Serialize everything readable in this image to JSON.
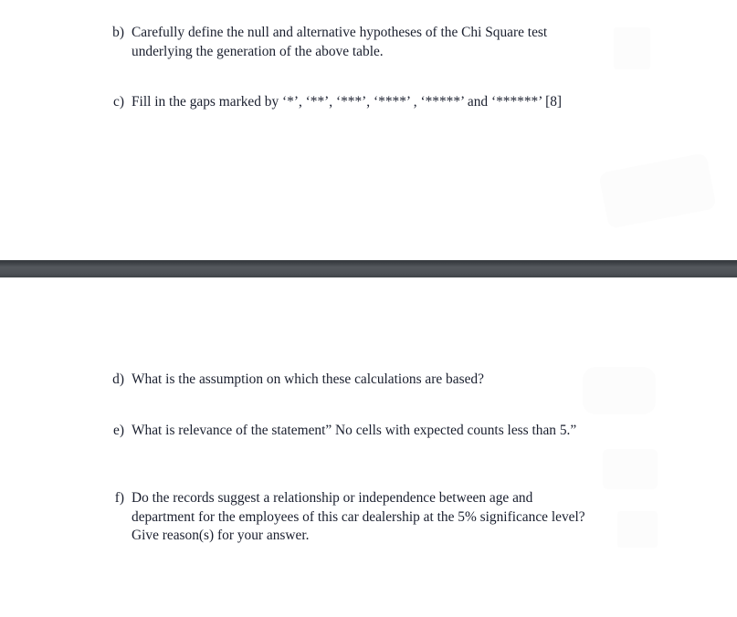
{
  "document": {
    "type": "scanned-exam-page",
    "background_color": "#ffffff",
    "text_color": "#1a1f2e"
  },
  "separator": {
    "color": "#4a4f54",
    "edge_color": "#383c41"
  },
  "questions_top": [
    {
      "marker": "b)",
      "lines": [
        "Carefully define the null and alternative hypotheses of the Chi Square test",
        "underlying the generation of the above table."
      ]
    },
    {
      "marker": "c)",
      "lines": [
        "Fill in the gaps marked by ‘*’, ‘**’, ‘***’, ‘****’ , ‘*****’ and ‘******’ [8]"
      ]
    }
  ],
  "questions_bottom": [
    {
      "marker": "d)",
      "lines": [
        "What is the assumption on which these calculations are based?"
      ]
    },
    {
      "marker": "e)",
      "lines": [
        "What is relevance of the statement” No cells with expected counts less than 5.”"
      ]
    },
    {
      "marker": "f)",
      "lines": [
        "Do the records suggest a relationship or independence between age and",
        "department for the employees of this car dealership at the 5% significance level?",
        "Give reason(s) for your answer."
      ]
    }
  ]
}
